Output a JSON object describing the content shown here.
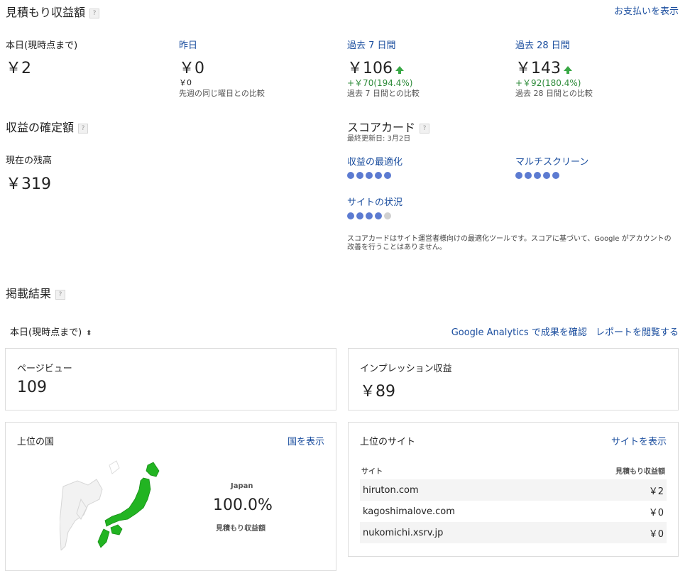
{
  "estimated": {
    "title": "見積もり収益額",
    "payment_link": "お支払いを表示",
    "today": {
      "label": "本日(現時点まで)",
      "value": "￥2"
    },
    "yesterday": {
      "label": "昨日",
      "value": "￥0",
      "diff": "￥0",
      "compare": "先週の同じ曜日との比較"
    },
    "last7": {
      "label": "過去 7 日間",
      "value": "￥106",
      "diff": "+￥70(194.4%)",
      "compare": "過去 7 日間との比較"
    },
    "last28": {
      "label": "過去 28 日間",
      "value": "￥143",
      "diff": "+￥92(180.4%)",
      "compare": "過去 28 日間との比較"
    }
  },
  "finalized": {
    "title": "収益の確定額",
    "balance_label": "現在の残高",
    "balance_value": "￥319"
  },
  "scorecard": {
    "title": "スコアカード",
    "updated": "最終更新日: 3月2日",
    "items": [
      {
        "label": "収益の最適化",
        "rating": 5
      },
      {
        "label": "マルチスクリーン",
        "rating": 5
      },
      {
        "label": "サイトの状況",
        "rating": 4
      }
    ],
    "note": "スコアカードはサイト運営者様向けの最適化ツールです。スコアに基づいて、Google がアカウントの改善を行うことはありません。",
    "accent_color": "#5c7bd1"
  },
  "performance": {
    "title": "掲載結果",
    "period_select": "本日(現時点まで)",
    "analytics_link": "Google Analytics で成果を確認",
    "report_link": "レポートを閲覧する",
    "pageviews": {
      "label": "ページビュー",
      "value": "109"
    },
    "impression_revenue": {
      "label": "インプレッション収益",
      "value": "￥89"
    }
  },
  "top_countries": {
    "title": "上位の国",
    "link": "国を表示",
    "country": "Japan",
    "percent": "100.0%",
    "metric": "見積もり収益額",
    "map_color": "#22b422"
  },
  "top_sites": {
    "title": "上位のサイト",
    "link": "サイトを表示",
    "col_site": "サイト",
    "col_value": "見積もり収益額",
    "rows": [
      {
        "site": "hiruton.com",
        "value": "￥2"
      },
      {
        "site": "kagoshimalove.com",
        "value": "￥0"
      },
      {
        "site": "nukomichi.xsrv.jp",
        "value": "￥0"
      }
    ]
  }
}
